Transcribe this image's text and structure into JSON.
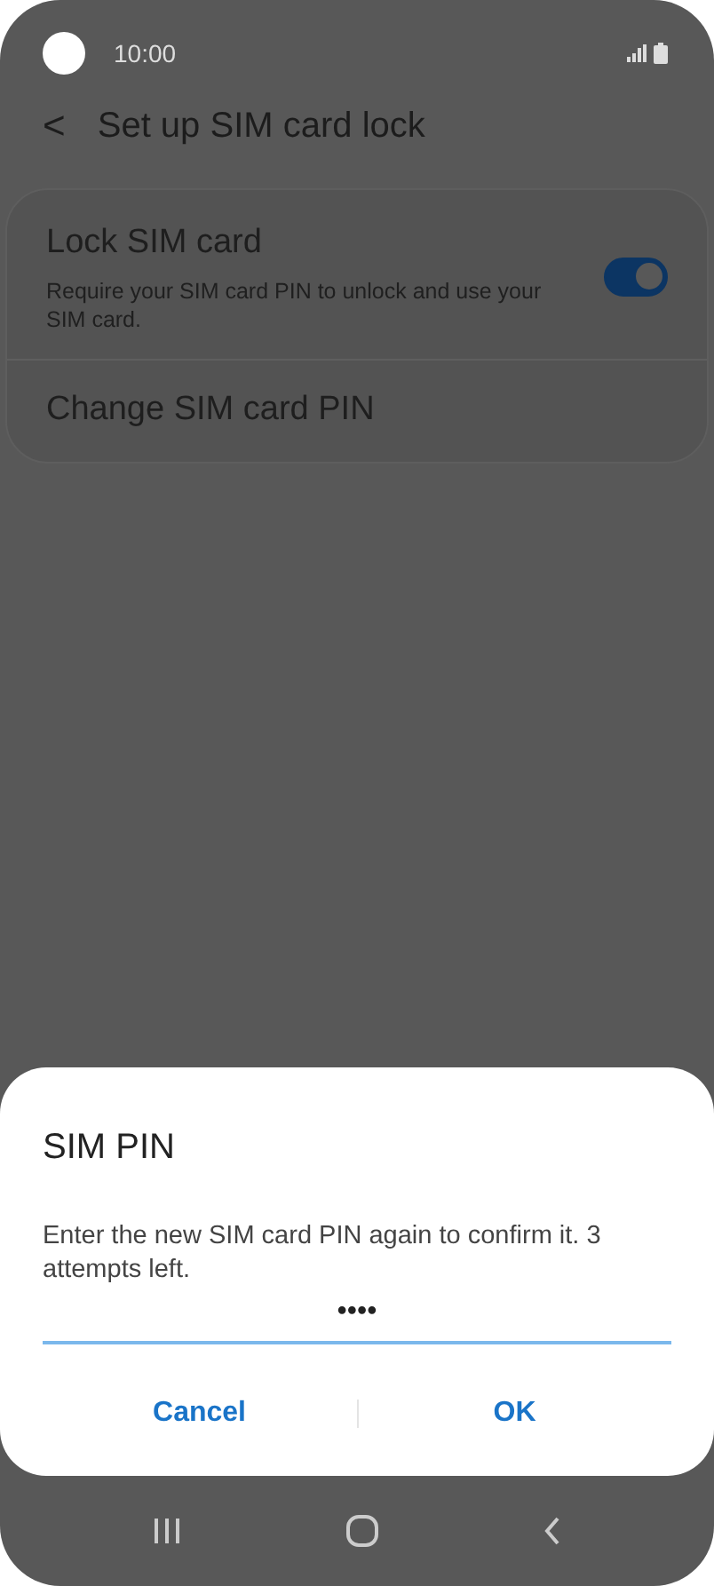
{
  "status_bar": {
    "time": "10:00"
  },
  "header": {
    "back": "<",
    "title": "Set up SIM card lock"
  },
  "settings": [
    {
      "kind": "toggle",
      "title": "Lock SIM card",
      "subtitle": "Require your SIM card PIN to unlock and use your SIM card.",
      "on": true
    },
    {
      "kind": "plain",
      "title": "Change SIM card PIN"
    }
  ],
  "dialog": {
    "title": "SIM PIN",
    "message": "Enter the new SIM card PIN again to confirm it. 3 attempts left.",
    "field": {
      "value": "••••"
    },
    "buttons": [
      "Cancel",
      "OK"
    ]
  }
}
